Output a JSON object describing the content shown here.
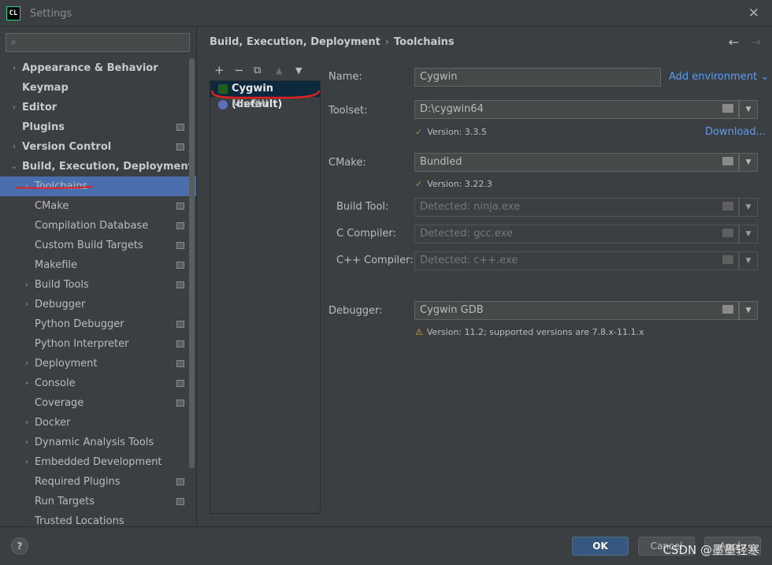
{
  "window": {
    "title": "Settings",
    "logo_text": "CL"
  },
  "sidebar": {
    "items": [
      {
        "label": "Appearance & Behavior",
        "bold": true,
        "arrow": "›",
        "level": 0
      },
      {
        "label": "Keymap",
        "bold": true,
        "arrow": "",
        "level": 0
      },
      {
        "label": "Editor",
        "bold": true,
        "arrow": "›",
        "level": 0
      },
      {
        "label": "Plugins",
        "bold": true,
        "arrow": "",
        "level": 0,
        "project": true
      },
      {
        "label": "Version Control",
        "bold": true,
        "arrow": "›",
        "level": 0,
        "project": true
      },
      {
        "label": "Build, Execution, Deployment",
        "bold": true,
        "arrow": "⌄",
        "level": 0
      },
      {
        "label": "Toolchains",
        "bold": false,
        "arrow": "›",
        "level": 1,
        "selected": true
      },
      {
        "label": "CMake",
        "bold": false,
        "arrow": "",
        "level": 1,
        "project": true
      },
      {
        "label": "Compilation Database",
        "bold": false,
        "arrow": "",
        "level": 1,
        "project": true
      },
      {
        "label": "Custom Build Targets",
        "bold": false,
        "arrow": "",
        "level": 1,
        "project": true
      },
      {
        "label": "Makefile",
        "bold": false,
        "arrow": "",
        "level": 1,
        "project": true
      },
      {
        "label": "Build Tools",
        "bold": false,
        "arrow": "›",
        "level": 1,
        "project": true
      },
      {
        "label": "Debugger",
        "bold": false,
        "arrow": "›",
        "level": 1
      },
      {
        "label": "Python Debugger",
        "bold": false,
        "arrow": "",
        "level": 1,
        "project": true
      },
      {
        "label": "Python Interpreter",
        "bold": false,
        "arrow": "",
        "level": 1,
        "project": true
      },
      {
        "label": "Deployment",
        "bold": false,
        "arrow": "›",
        "level": 1,
        "project": true
      },
      {
        "label": "Console",
        "bold": false,
        "arrow": "›",
        "level": 1,
        "project": true
      },
      {
        "label": "Coverage",
        "bold": false,
        "arrow": "",
        "level": 1,
        "project": true
      },
      {
        "label": "Docker",
        "bold": false,
        "arrow": "›",
        "level": 1
      },
      {
        "label": "Dynamic Analysis Tools",
        "bold": false,
        "arrow": "›",
        "level": 1
      },
      {
        "label": "Embedded Development",
        "bold": false,
        "arrow": "›",
        "level": 1
      },
      {
        "label": "Required Plugins",
        "bold": false,
        "arrow": "",
        "level": 1,
        "project": true
      },
      {
        "label": "Run Targets",
        "bold": false,
        "arrow": "",
        "level": 1,
        "project": true
      },
      {
        "label": "Trusted Locations",
        "bold": false,
        "arrow": "",
        "level": 1
      }
    ]
  },
  "breadcrumb": {
    "parent": "Build, Execution, Deployment",
    "sep": "›",
    "current": "Toolchains"
  },
  "toolbar": {
    "add": "+",
    "remove": "−",
    "copy": "⧉",
    "up": "▲",
    "down": "▼"
  },
  "toolchains": [
    {
      "name": "Cygwin (default)",
      "selected": true,
      "icon_color": "#2e8b2e"
    },
    {
      "name": "MinGW",
      "selected": false,
      "icon_color": "#5a6fbf"
    }
  ],
  "form": {
    "name_label": "Name:",
    "name_value": "Cygwin",
    "add_environment": "Add environment ⌄",
    "toolset_label": "Toolset:",
    "toolset_value": "D:\\cygwin64",
    "toolset_version": "Version: 3.3.5",
    "download_link": "Download...",
    "cmake_label": "CMake:",
    "cmake_value": "Bundled",
    "cmake_version": "Version: 3.22.3",
    "build_tool_label": "Build Tool:",
    "build_tool_placeholder": "Detected: ninja.exe",
    "c_compiler_label": "C Compiler:",
    "c_compiler_placeholder": "Detected: gcc.exe",
    "cpp_compiler_label": "C++ Compiler:",
    "cpp_compiler_placeholder": "Detected: c++.exe",
    "debugger_label": "Debugger:",
    "debugger_value": "Cygwin GDB",
    "debugger_version": "Version: 11.2; supported versions are 7.8.x-11.1.x"
  },
  "footer": {
    "help": "?",
    "ok": "OK",
    "cancel": "Cancel",
    "apply": "Apply",
    "watermark": "CSDN @墨墨轻寒"
  },
  "colors": {
    "accent": "#4b6eaf",
    "link": "#589df6",
    "ok": "#5fb847",
    "warning": "#e0a530",
    "annotation": "#e02020"
  }
}
